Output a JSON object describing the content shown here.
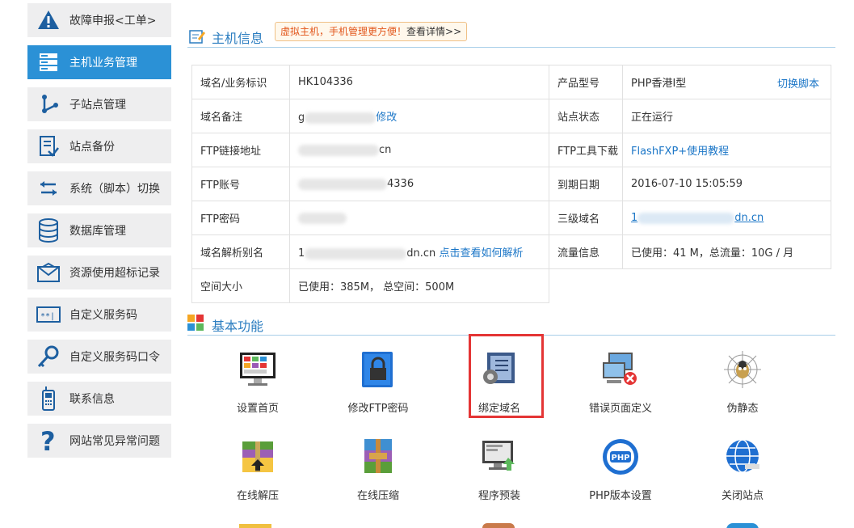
{
  "sidebar": {
    "items": [
      {
        "label": "故障申报<工单>",
        "icon": "warning-icon"
      },
      {
        "label": "主机业务管理",
        "icon": "server-icon",
        "active": true
      },
      {
        "label": "子站点管理",
        "icon": "branch-icon"
      },
      {
        "label": "站点备份",
        "icon": "backup-icon"
      },
      {
        "label": "系统（脚本）切换",
        "icon": "switch-icon"
      },
      {
        "label": "数据库管理",
        "icon": "database-icon"
      },
      {
        "label": "资源使用超标记录",
        "icon": "mail-icon"
      },
      {
        "label": "自定义服务码",
        "icon": "code-icon"
      },
      {
        "label": "自定义服务码口令",
        "icon": "key-icon"
      },
      {
        "label": "联系信息",
        "icon": "phone-icon"
      },
      {
        "label": "网站常见异常问题",
        "icon": "question-icon"
      }
    ]
  },
  "host_info": {
    "title": "主机信息",
    "notice": "虚拟主机，手机管理更方便！",
    "notice_link": "查看详情>>"
  },
  "table": {
    "domain_label": "域名/业务标识",
    "domain_value": "HK104336",
    "product_label": "产品型号",
    "product_value": "PHP香港I型",
    "switch_script": "切换脚本",
    "record_label": "域名备注",
    "record_prefix": "g",
    "record_link": "修改",
    "status_label": "站点状态",
    "status_value": "正在运行",
    "ftp_addr_label": "FTP链接地址",
    "ftp_addr_suffix": "cn",
    "ftp_tool_label": "FTP工具下载",
    "ftp_tool_link": "FlashFXP+使用教程",
    "ftp_account_label": "FTP账号",
    "ftp_account_suffix": "4336",
    "expire_label": "到期日期",
    "expire_value": "2016-07-10 15:05:59",
    "ftp_pwd_label": "FTP密码",
    "third_domain_label": "三级域名",
    "third_domain_prefix": "1",
    "third_domain_suffix": "dn.cn",
    "alias_label": "域名解析别名",
    "alias_prefix": "1",
    "alias_suffix": "dn.cn",
    "alias_link": "点击查看如何解析",
    "traffic_label": "流量信息",
    "traffic_value": "已使用：41 M，总流量：10G / 月",
    "space_label": "空间大小",
    "space_value": "已使用：385M， 总空间：500M"
  },
  "basic": {
    "title": "基本功能",
    "features": [
      {
        "label": "设置首页",
        "icon": "monitor-icon"
      },
      {
        "label": "修改FTP密码",
        "icon": "lock-icon"
      },
      {
        "label": "绑定域名",
        "icon": "gear-panel-icon"
      },
      {
        "label": "错误页面定义",
        "icon": "error-computer-icon"
      },
      {
        "label": "伪静态",
        "icon": "spider-icon"
      },
      {
        "label": "在线解压",
        "icon": "archive-up-icon"
      },
      {
        "label": "在线压缩",
        "icon": "archive-icon"
      },
      {
        "label": "程序预装",
        "icon": "install-icon"
      },
      {
        "label": "PHP版本设置",
        "icon": "php-icon"
      },
      {
        "label": "关闭站点",
        "icon": "globe-icon"
      }
    ]
  },
  "colors": {
    "accent": "#2b91d6",
    "link": "#1b76c7",
    "highlight": "#e43535"
  }
}
